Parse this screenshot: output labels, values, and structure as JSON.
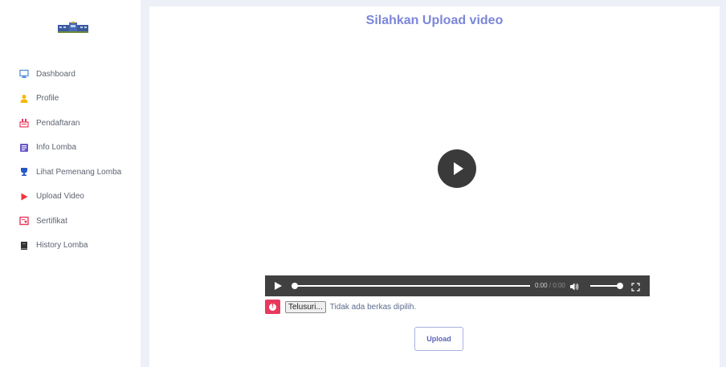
{
  "sidebar": {
    "logo_icon": "school-building-logo",
    "items": [
      {
        "label": "Dashboard",
        "icon": "monitor-icon",
        "color": "#4a8ad4"
      },
      {
        "label": "Profile",
        "icon": "user-icon",
        "color": "#f5b800"
      },
      {
        "label": "Pendaftaran",
        "icon": "signup-icon",
        "color": "#e8395d"
      },
      {
        "label": "Info Lomba",
        "icon": "info-icon",
        "color": "#6a55c9"
      },
      {
        "label": "Lihat Pemenang Lomba",
        "icon": "trophy-icon",
        "color": "#2757c4"
      },
      {
        "label": "Upload Video",
        "icon": "play-icon",
        "color": "#f0343d"
      },
      {
        "label": "Sertifikat",
        "icon": "certificate-icon",
        "color": "#e8395d"
      },
      {
        "label": "History Lomba",
        "icon": "book-icon",
        "color": "#333333"
      }
    ]
  },
  "main": {
    "title": "Silahkan Upload video",
    "video": {
      "current_time": "0:00",
      "separator": "/",
      "duration": "0:00",
      "progress": 0,
      "volume": 1
    },
    "file_input": {
      "browse_label": "Telusuri...",
      "status": "Tidak ada berkas dipilih."
    },
    "upload_label": "Upload"
  },
  "colors": {
    "accent": "#7b86d9",
    "error": "#e8395d",
    "background": "#eef0f8"
  }
}
